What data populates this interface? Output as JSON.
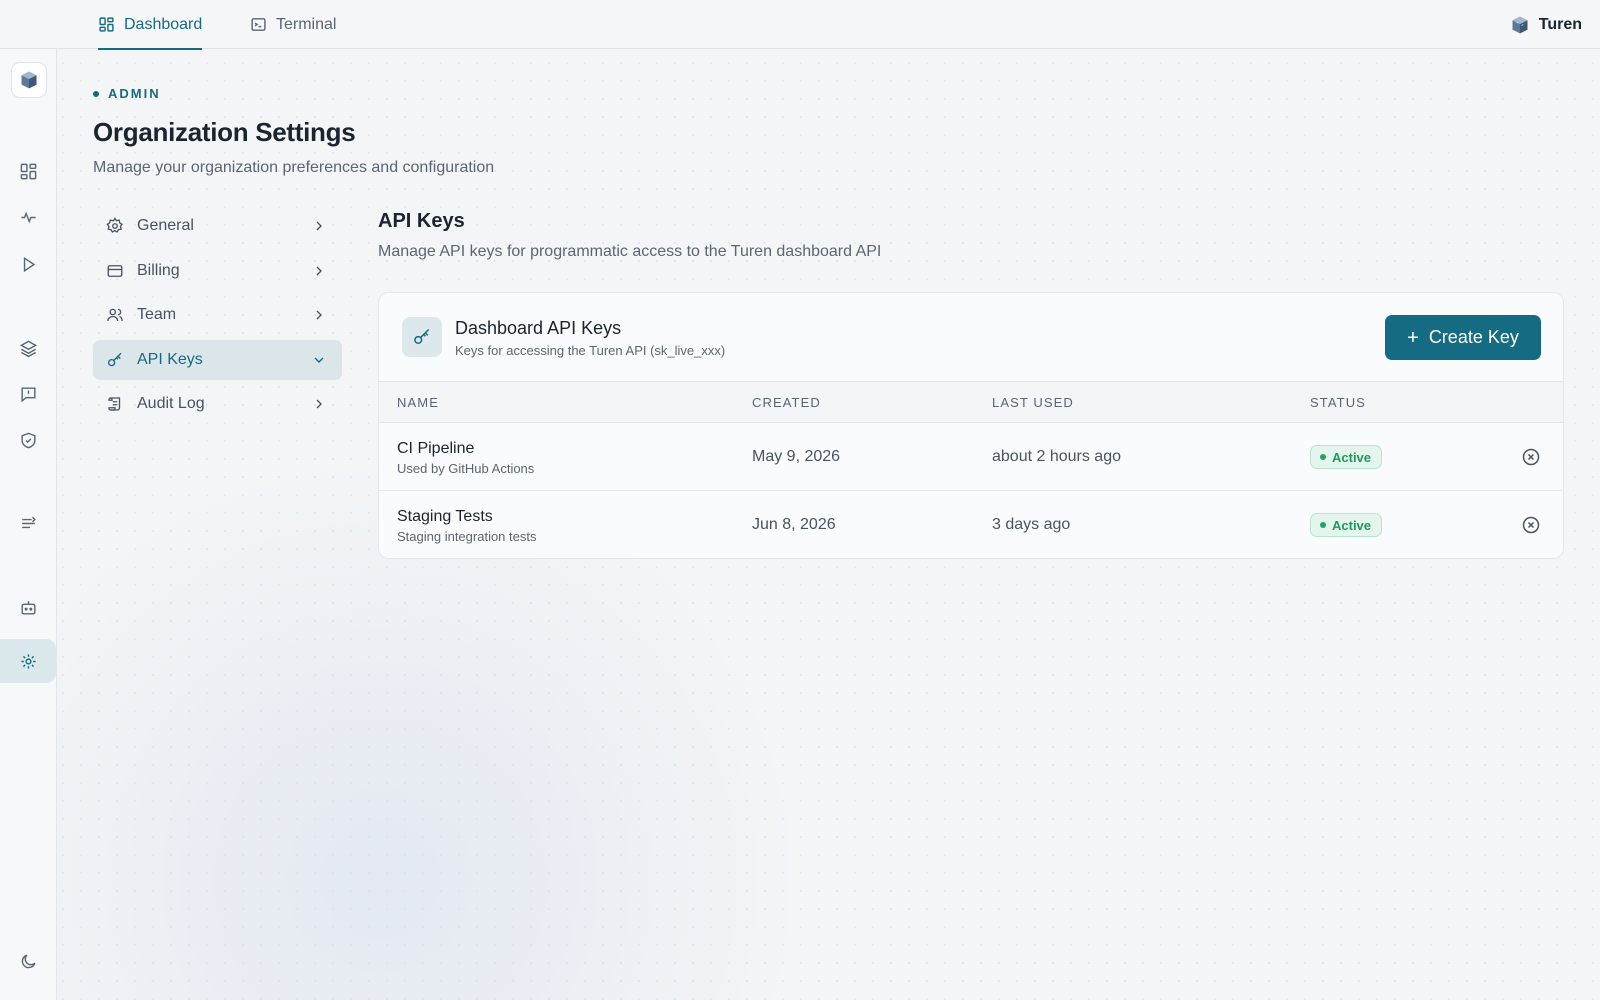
{
  "topbar": {
    "tabs": [
      {
        "label": "Dashboard",
        "icon": "dashboard-icon",
        "active": true
      },
      {
        "label": "Terminal",
        "icon": "terminal-icon",
        "active": false
      }
    ],
    "brand": "Turen"
  },
  "rail": {
    "items": [
      "dashboard-icon",
      "activity-icon",
      "play-icon",
      "layers-icon",
      "message-alert-icon",
      "shield-icon",
      "route-icon",
      "bot-icon",
      "settings-sun-icon"
    ],
    "active": "settings-sun-icon",
    "footer": "moon-icon"
  },
  "header": {
    "eyebrow": "ADMIN",
    "title": "Organization Settings",
    "subtitle": "Manage your organization preferences and configuration"
  },
  "settings_nav": {
    "items": [
      {
        "label": "General",
        "icon": "gear-icon"
      },
      {
        "label": "Billing",
        "icon": "credit-card-icon"
      },
      {
        "label": "Team",
        "icon": "users-icon"
      },
      {
        "label": "API Keys",
        "icon": "key-icon",
        "active": true
      },
      {
        "label": "Audit Log",
        "icon": "scroll-icon"
      }
    ]
  },
  "section": {
    "title": "API Keys",
    "subtitle": "Manage API keys for programmatic access to the Turen dashboard API"
  },
  "card": {
    "title": "Dashboard API Keys",
    "description": "Keys for accessing the Turen API (sk_live_xxx)",
    "create_label": "Create Key",
    "columns": [
      "NAME",
      "CREATED",
      "LAST USED",
      "STATUS"
    ],
    "rows": [
      {
        "name": "CI Pipeline",
        "description": "Used by GitHub Actions",
        "created": "May 9, 2026",
        "last_used": "about 2 hours ago",
        "status": "Active"
      },
      {
        "name": "Staging Tests",
        "description": "Staging integration tests",
        "created": "Jun 8, 2026",
        "last_used": "3 days ago",
        "status": "Active"
      }
    ]
  },
  "colors": {
    "accent": "#146b82",
    "active_badge": "#1f9a5f"
  }
}
